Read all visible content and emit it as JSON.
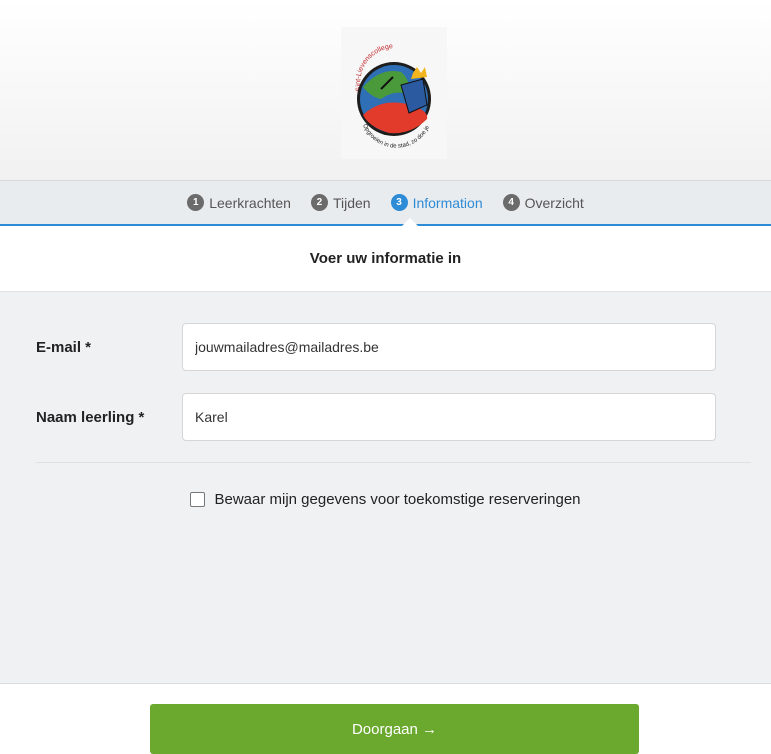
{
  "header": {
    "logo_text_top": "Sint-Lievenscollege",
    "logo_text_bottom": "Opgroeien in de stad, zo doe je dat!"
  },
  "steps": [
    {
      "num": "1",
      "label": "Leerkrachten",
      "active": false
    },
    {
      "num": "2",
      "label": "Tijden",
      "active": false
    },
    {
      "num": "3",
      "label": "Information",
      "active": true
    },
    {
      "num": "4",
      "label": "Overzicht",
      "active": false
    }
  ],
  "section_title": "Voer uw informatie in",
  "form": {
    "email_label": "E-mail *",
    "email_value": "jouwmailadres@mailadres.be",
    "name_label": "Naam leerling *",
    "name_value": "Karel",
    "remember_label": "Bewaar mijn gegevens voor toekomstige reserveringen"
  },
  "footer": {
    "continue_label": "Doorgaan →"
  },
  "colors": {
    "accent": "#2e8bd6",
    "button": "#6aa82e"
  }
}
